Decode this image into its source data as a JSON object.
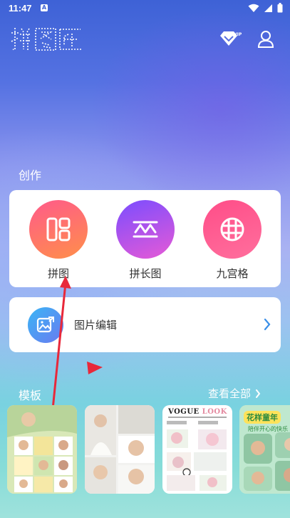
{
  "status_bar": {
    "time": "11:47",
    "notification_glyph": "A"
  },
  "app": {
    "logo_text": "拼图匠",
    "vip_label": "VIP"
  },
  "create_section": {
    "title": "创作",
    "items": [
      {
        "label": "拼图",
        "icon": "collage-grid-icon",
        "color_from": "#ff5f7e",
        "color_to": "#ff9a3c"
      },
      {
        "label": "拼长图",
        "icon": "long-stitch-icon",
        "color_from": "#8a4dff",
        "color_to": "#e65ad6"
      },
      {
        "label": "九宫格",
        "icon": "nine-grid-icon",
        "color_from": "#ff4d88",
        "color_to": "#ff7aa5"
      }
    ]
  },
  "edit_section": {
    "label": "图片编辑",
    "icon": "image-edit-icon"
  },
  "templates_section": {
    "title": "模板",
    "view_all": "查看全部",
    "cards": [
      {
        "name": "template-1"
      },
      {
        "name": "template-2"
      },
      {
        "name": "template-3",
        "header_dark": "VOGUE",
        "header_pink": "LOOK"
      },
      {
        "name": "template-4",
        "title": "花样童年",
        "subtitle": "陪伴开心的快乐"
      }
    ]
  }
}
